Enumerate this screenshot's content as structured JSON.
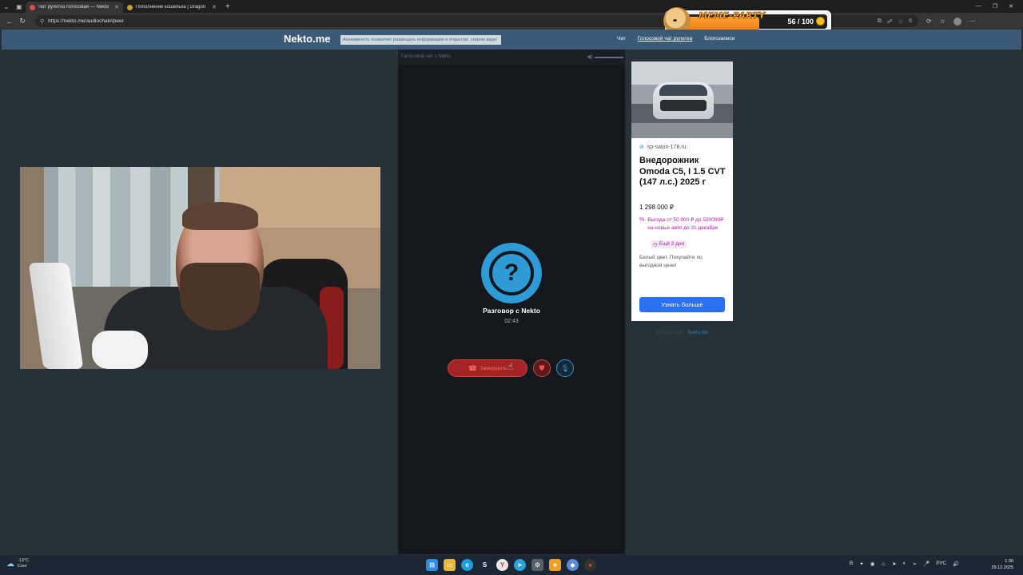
{
  "browser": {
    "tabs": [
      {
        "title": "Чат рулетка голосовая — Nekto",
        "active": true,
        "favicon_color": "#e04a4a"
      },
      {
        "title": "Пополнение кошелька | Dragon",
        "active": false,
        "favicon_color": "#c7a13a"
      }
    ],
    "url": "https://nekto.me/audiochat#/peer",
    "extension_count": "6"
  },
  "overlay": {
    "title": "MEME-PARTY",
    "count": "56 / 100",
    "progress": 0.56
  },
  "site": {
    "logo": "Nekto.me",
    "notice": "Анонимность позволяет размещать информацию в открытом, скором виде!",
    "nav": [
      {
        "label": "Чат",
        "active": false
      },
      {
        "label": "Голосовой чат рулетка",
        "active": true
      },
      {
        "label": "Блогозаписи",
        "active": false
      }
    ]
  },
  "chat": {
    "header": "Голосовой чат с Nekto",
    "conversation_title": "Разговор с Nekto",
    "timer": "02:43",
    "end_button": "Завершить",
    "avatar_symbol": "?"
  },
  "ad": {
    "domain": "sp-salon-178.ru",
    "title": "Внедорожник Omoda C5, I 1.5 CVT (147 л.с.) 2025 г",
    "price": "1 298 000 ₽",
    "promo": "Выгода от 50 000 ₽ до 500000₽ на новые авто до 31 декабря",
    "days_left": "Ещё 2 дня",
    "description": "Белый цвет. Покупайте по выгодной цене!",
    "cta": "Узнать больше",
    "footer_copyright": "© 2011-2025",
    "footer_link": "Nekto.Me"
  },
  "taskbar": {
    "temperature": "-13°C",
    "weather": "Снег",
    "lang": "РУС",
    "time": "1:30",
    "date": "29.12.2025"
  }
}
